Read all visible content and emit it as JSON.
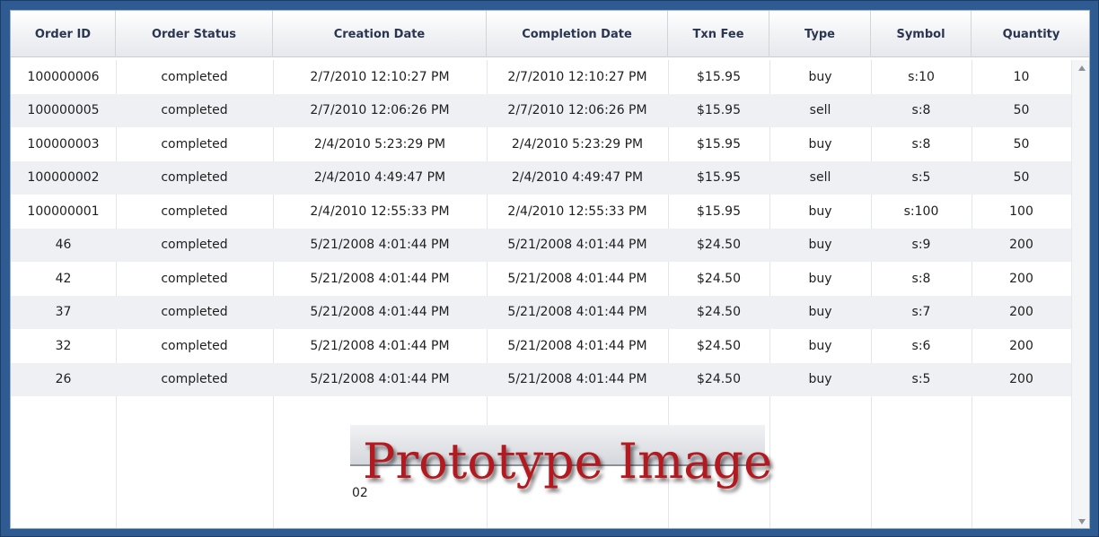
{
  "table": {
    "columns": [
      "Order ID",
      "Order Status",
      "Creation Date",
      "Completion Date",
      "Txn Fee",
      "Type",
      "Symbol",
      "Quantity"
    ],
    "rows": [
      [
        "100000006",
        "completed",
        "2/7/2010 12:10:27 PM",
        "2/7/2010 12:10:27 PM",
        "$15.95",
        "buy",
        "s:10",
        "10"
      ],
      [
        "100000005",
        "completed",
        "2/7/2010 12:06:26 PM",
        "2/7/2010 12:06:26 PM",
        "$15.95",
        "sell",
        "s:8",
        "50"
      ],
      [
        "100000003",
        "completed",
        "2/4/2010 5:23:29 PM",
        "2/4/2010 5:23:29 PM",
        "$15.95",
        "buy",
        "s:8",
        "50"
      ],
      [
        "100000002",
        "completed",
        "2/4/2010 4:49:47 PM",
        "2/4/2010 4:49:47 PM",
        "$15.95",
        "sell",
        "s:5",
        "50"
      ],
      [
        "100000001",
        "completed",
        "2/4/2010 12:55:33 PM",
        "2/4/2010 12:55:33 PM",
        "$15.95",
        "buy",
        "s:100",
        "100"
      ],
      [
        "46",
        "completed",
        "5/21/2008 4:01:44 PM",
        "5/21/2008 4:01:44 PM",
        "$24.50",
        "buy",
        "s:9",
        "200"
      ],
      [
        "42",
        "completed",
        "5/21/2008 4:01:44 PM",
        "5/21/2008 4:01:44 PM",
        "$24.50",
        "buy",
        "s:8",
        "200"
      ],
      [
        "37",
        "completed",
        "5/21/2008 4:01:44 PM",
        "5/21/2008 4:01:44 PM",
        "$24.50",
        "buy",
        "s:7",
        "200"
      ],
      [
        "32",
        "completed",
        "5/21/2008 4:01:44 PM",
        "5/21/2008 4:01:44 PM",
        "$24.50",
        "buy",
        "s:6",
        "200"
      ],
      [
        "26",
        "completed",
        "5/21/2008 4:01:44 PM",
        "5/21/2008 4:01:44 PM",
        "$24.50",
        "buy",
        "s:5",
        "200"
      ]
    ]
  },
  "watermark": {
    "text": "Prototype Image",
    "fragment": "02"
  },
  "icons": {
    "scroll_up": "scroll-up-arrow-icon",
    "scroll_down": "scroll-down-arrow-icon"
  },
  "colors": {
    "frame": "#2f5b93",
    "alt_row": "#eef0f4",
    "watermark_text": "#b3191f"
  }
}
